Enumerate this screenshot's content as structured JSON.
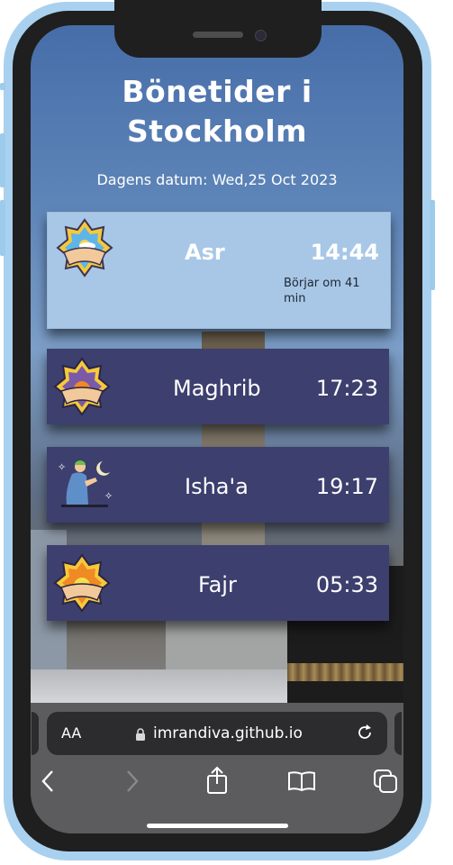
{
  "page": {
    "title": "Bönetider i Stockholm",
    "date_label": "Dagens datum: Wed,25 Oct 2023"
  },
  "prayers": [
    {
      "name": "Asr",
      "time": "14:44",
      "status": "Börjar om 41 min",
      "active": true,
      "icon": "sun-afternoon-icon"
    },
    {
      "name": "Maghrib",
      "time": "17:23",
      "active": false,
      "icon": "sunset-icon"
    },
    {
      "name": "Isha'a",
      "time": "19:17",
      "active": false,
      "icon": "praying-man-moon-icon"
    },
    {
      "name": "Fajr",
      "time": "05:33",
      "active": false,
      "icon": "sunrise-icon"
    }
  ],
  "browser": {
    "text_size_label": "AA",
    "url": "imrandiva.github.io",
    "icons": [
      "lock-icon",
      "reload-icon",
      "back-icon",
      "forward-icon",
      "share-icon",
      "bookmarks-icon",
      "tabs-icon"
    ]
  },
  "colors": {
    "active_card": "#a8c7e7",
    "card": "#3d3f6e",
    "phone_frame": "#a9d1ef"
  }
}
